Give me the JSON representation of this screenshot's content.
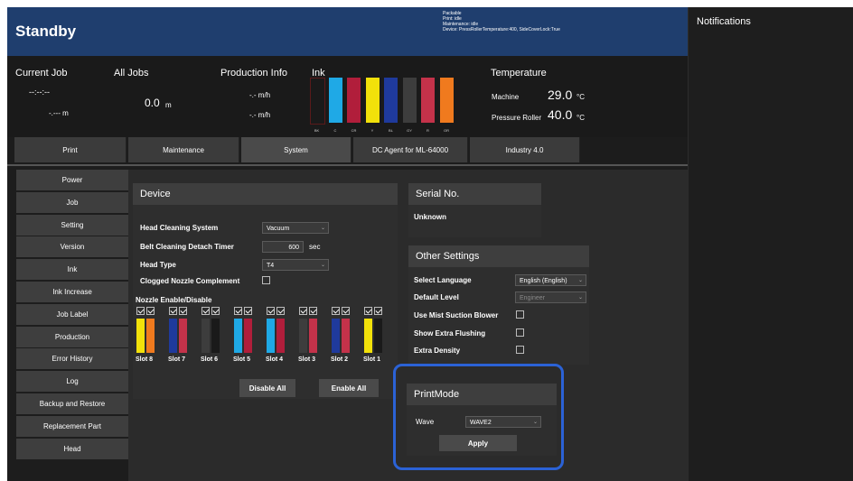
{
  "title": "Standby",
  "status_lines": [
    "Packable",
    "Print: idle",
    "Maintenance: idle",
    "Device: PressRollerTemperature:400, SideCoverLock:True"
  ],
  "notifications": {
    "title": "Notifications"
  },
  "info": {
    "current_job": {
      "label": "Current Job",
      "time": "--:--:--",
      "length": "-.--- m"
    },
    "all_jobs": {
      "label": "All Jobs",
      "value": "0.0",
      "unit": "m"
    },
    "production": {
      "label": "Production Info",
      "line1": "-.- m/h",
      "line2": "-.- m/h"
    },
    "ink": {
      "label": "Ink",
      "bars": [
        {
          "code": "BK",
          "color": "#1a1a1a"
        },
        {
          "code": "C",
          "color": "#1fa9e6"
        },
        {
          "code": "CR",
          "color": "#b11e3b"
        },
        {
          "code": "Y",
          "color": "#f2e10a"
        },
        {
          "code": "BL",
          "color": "#1f3a9c"
        },
        {
          "code": "GY",
          "color": "#3d3d3d"
        },
        {
          "code": "R",
          "color": "#c4324a"
        },
        {
          "code": "OR",
          "color": "#f07a1e"
        }
      ]
    },
    "temperature": {
      "label": "Temperature",
      "machine": {
        "label": "Machine",
        "value": "29.0",
        "unit": "°C"
      },
      "roller": {
        "label": "Pressure Roller",
        "value": "40.0",
        "unit": "°C"
      }
    }
  },
  "tabs": [
    "Print",
    "Maintenance",
    "System",
    "DC Agent for ML-64000",
    "Industry 4.0"
  ],
  "active_tab": "System",
  "menu": [
    "Power",
    "Job",
    "Setting",
    "Version",
    "Ink",
    "Ink Increase",
    "Job Label",
    "Production",
    "Error History",
    "Log",
    "Backup and Restore",
    "Replacement Part",
    "Head"
  ],
  "device": {
    "title": "Device",
    "head_cleaning": {
      "label": "Head Cleaning System",
      "value": "Vacuum"
    },
    "belt_timer": {
      "label": "Belt Cleaning Detach Timer",
      "value": "600",
      "unit": "sec"
    },
    "head_type": {
      "label": "Head Type",
      "value": "T4"
    },
    "clogged": {
      "label": "Clogged Nozzle Complement"
    },
    "nozzle_label": "Nozzle Enable/Disable",
    "slots": [
      {
        "label": "Slot 8",
        "colors": [
          "#f2e10a",
          "#f07a1e"
        ]
      },
      {
        "label": "Slot 7",
        "colors": [
          "#1f3a9c",
          "#c4324a"
        ]
      },
      {
        "label": "Slot 6",
        "colors": [
          "#3d3d3d",
          "#1a1a1a"
        ]
      },
      {
        "label": "Slot 5",
        "colors": [
          "#1fa9e6",
          "#b11e3b"
        ]
      },
      {
        "label": "Slot 4",
        "colors": [
          "#1fa9e6",
          "#b11e3b"
        ]
      },
      {
        "label": "Slot 3",
        "colors": [
          "#3d3d3d",
          "#c4324a"
        ]
      },
      {
        "label": "Slot 2",
        "colors": [
          "#1f3a9c",
          "#c4324a"
        ]
      },
      {
        "label": "Slot 1",
        "colors": [
          "#f2e10a",
          "#1a1a1a"
        ]
      }
    ],
    "disable_all": "Disable All",
    "enable_all": "Enable All"
  },
  "serial": {
    "title": "Serial No.",
    "value": "Unknown"
  },
  "other": {
    "title": "Other Settings",
    "language": {
      "label": "Select Language",
      "value": "English (English)"
    },
    "default_level": {
      "label": "Default Level",
      "value": "Engineer"
    },
    "mist": {
      "label": "Use Mist Suction Blower"
    },
    "flushing": {
      "label": "Show Extra Flushing"
    },
    "density": {
      "label": "Extra Density"
    }
  },
  "printmode": {
    "title": "PrintMode",
    "wave_label": "Wave",
    "wave_value": "WAVE2",
    "apply": "Apply"
  }
}
